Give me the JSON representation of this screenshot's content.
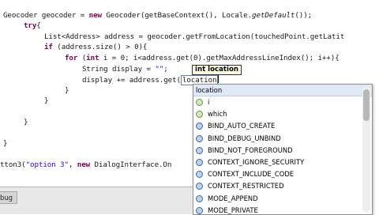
{
  "editor": {
    "lines": [
      {
        "id": "l1",
        "segments": [
          {
            "t": "Geocoder geocoder = "
          },
          {
            "t": "new",
            "c": "kw"
          },
          {
            "t": " Geocoder(getBaseContext(), Locale."
          },
          {
            "t": "getDefault",
            "c": "it"
          },
          {
            "t": "());"
          }
        ]
      },
      {
        "id": "l2",
        "segments": [
          {
            "t": "try",
            "c": "kw"
          },
          {
            "t": "{"
          }
        ]
      },
      {
        "id": "l3",
        "segments": [
          {
            "t": "List<Address> address = geocoder.getFromLocation(touchedPoint.getLatit"
          }
        ]
      },
      {
        "id": "l4",
        "segments": [
          {
            "t": "if",
            "c": "kw"
          },
          {
            "t": " (address.size() > 0){"
          }
        ]
      },
      {
        "id": "l5",
        "segments": [
          {
            "t": "for",
            "c": "kw"
          },
          {
            "t": " ("
          },
          {
            "t": "int",
            "c": "kw"
          },
          {
            "t": " i = 0; i<address.get(0).getMaxAddressLineIndex(); i++){"
          }
        ]
      },
      {
        "id": "l6",
        "segments": [
          {
            "t": "String display = "
          },
          {
            "t": "\"\"",
            "c": "str"
          },
          {
            "t": ";"
          }
        ]
      },
      {
        "id": "l7",
        "segments": [
          {
            "t": "display += address.get("
          }
        ]
      },
      {
        "id": "l8",
        "segments": [
          {
            "t": "}"
          }
        ]
      },
      {
        "id": "l9",
        "segments": [
          {
            "t": "}"
          }
        ]
      },
      {
        "id": "l10",
        "segments": [
          {
            "t": "}"
          }
        ]
      },
      {
        "id": "l11",
        "segments": [
          {
            "t": "}"
          }
        ]
      },
      {
        "id": "l12",
        "segments": [
          {
            "t": "tton3("
          },
          {
            "t": "\"option 3\"",
            "c": "str"
          },
          {
            "t": ", "
          },
          {
            "t": "new",
            "c": "kw"
          },
          {
            "t": " DialogInterface.On"
          }
        ]
      }
    ],
    "typed_token": "location"
  },
  "tooltip": {
    "text": "int location"
  },
  "completion": {
    "header": "location",
    "items": [
      {
        "label": "i",
        "icon": "local-variable-icon"
      },
      {
        "label": "which",
        "icon": "local-variable-icon"
      },
      {
        "label": "BIND_AUTO_CREATE",
        "icon": "constant-field-icon"
      },
      {
        "label": "BIND_DEBUG_UNBIND",
        "icon": "constant-field-icon"
      },
      {
        "label": "BIND_NOT_FOREGROUND",
        "icon": "constant-field-icon"
      },
      {
        "label": "CONTEXT_IGNORE_SECURITY",
        "icon": "constant-field-icon"
      },
      {
        "label": "CONTEXT_INCLUDE_CODE",
        "icon": "constant-field-icon"
      },
      {
        "label": "CONTEXT_RESTRICTED",
        "icon": "constant-field-icon"
      },
      {
        "label": "MODE_APPEND",
        "icon": "constant-field-icon"
      },
      {
        "label": "MODE_PRIVATE",
        "icon": "constant-field-icon"
      }
    ]
  },
  "bottom": {
    "tab_label": "bug"
  }
}
